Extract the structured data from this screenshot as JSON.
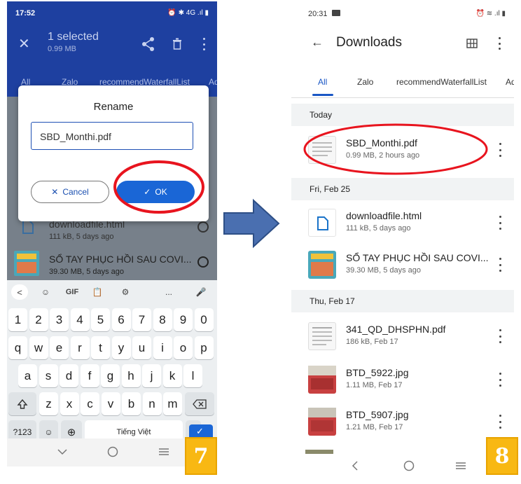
{
  "left_phone": {
    "status": {
      "time": "17:52",
      "icons": "⏰ ✱ 4G .ıl ▮"
    },
    "appbar": {
      "selected_title": "1 selected",
      "selected_size": "0.99 MB"
    },
    "tabs": [
      "All",
      "Zalo",
      "recommendWaterfallList",
      "Ad"
    ],
    "dialog": {
      "title": "Rename",
      "input_value": "SBD_Monthi.pdf",
      "cancel_label": "Cancel",
      "ok_label": "OK"
    },
    "behind_rows": [
      {
        "name": "downloadfile.html",
        "meta": "111 kB, 5 days ago"
      },
      {
        "name": "SỔ TAY PHỤC HỒI SAU COVI...",
        "meta": "39.30 MB, 5 days ago"
      }
    ],
    "keyboard": {
      "toolbar": [
        "<",
        "☺",
        "GIF",
        "📋",
        "⚙",
        "...",
        "🎤"
      ],
      "numbers": [
        "1",
        "2",
        "3",
        "4",
        "5",
        "6",
        "7",
        "8",
        "9",
        "0"
      ],
      "row1": [
        "q",
        "w",
        "e",
        "r",
        "t",
        "y",
        "u",
        "i",
        "o",
        "p"
      ],
      "row2": [
        "a",
        "s",
        "d",
        "f",
        "g",
        "h",
        "j",
        "k",
        "l"
      ],
      "row3": [
        "z",
        "x",
        "c",
        "v",
        "b",
        "n",
        "m"
      ],
      "symbols_label": "?123",
      "space_label": "Tiếng Việt",
      "period_label": "."
    },
    "step_number": "7"
  },
  "right_phone": {
    "status": {
      "time": "20:31",
      "icons": "⏰ ≋ .ıl ▮"
    },
    "appbar": {
      "title": "Downloads"
    },
    "tabs": [
      "All",
      "Zalo",
      "recommendWaterfallList",
      "Ad"
    ],
    "sections": [
      {
        "header": "Today",
        "files": [
          {
            "name": "SBD_Monthi.pdf",
            "meta": "0.99 MB, 2 hours ago"
          }
        ]
      },
      {
        "header": "Fri, Feb 25",
        "files": [
          {
            "name": "downloadfile.html",
            "meta": "111 kB, 5 days ago"
          },
          {
            "name": "SỔ TAY PHỤC HỒI SAU COVI...",
            "meta": "39.30 MB, 5 days ago"
          }
        ]
      },
      {
        "header": "Thu, Feb 17",
        "files": [
          {
            "name": "341_QD_DHSPHN.pdf",
            "meta": "186 kB, Feb 17"
          },
          {
            "name": "BTD_5922.jpg",
            "meta": "1.11 MB, Feb 17"
          },
          {
            "name": "BTD_5907.jpg",
            "meta": "1.21 MB, Feb 17"
          }
        ]
      }
    ],
    "step_number": "8"
  },
  "colors": {
    "primary_blue": "#1e40a0",
    "ok_blue": "#1a66d6",
    "highlight_red": "#e8141e",
    "arrow_blue": "#4a6fb0",
    "badge_yellow": "#f8b813"
  }
}
